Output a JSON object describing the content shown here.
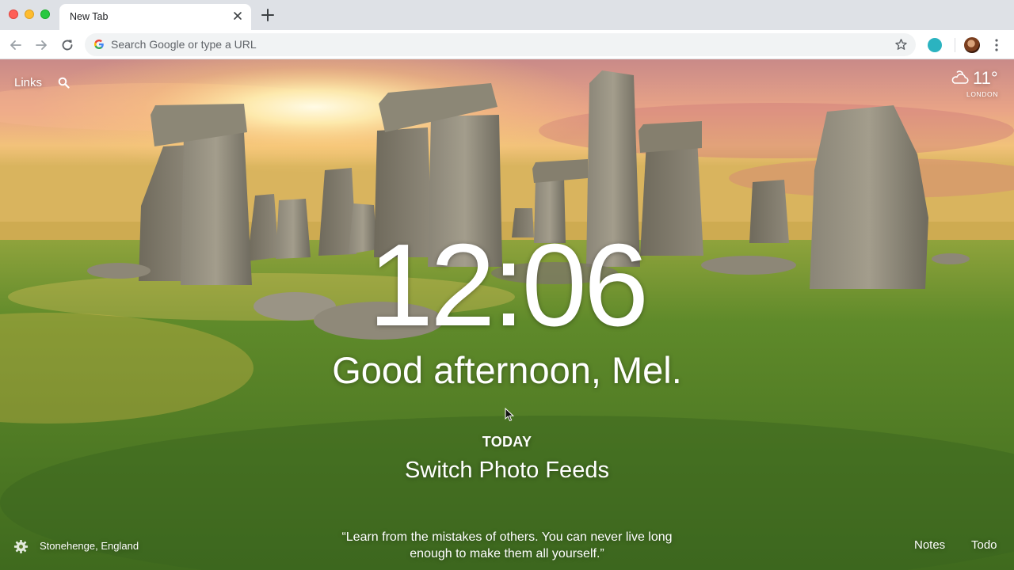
{
  "browser": {
    "tab_title": "New Tab",
    "omnibox_placeholder": "Search Google or type a URL"
  },
  "dashboard": {
    "links_label": "Links",
    "weather": {
      "temperature": "11°",
      "location": "LONDON",
      "icon": "partly-cloudy-icon"
    },
    "clock": "12:06",
    "greeting": "Good afternoon, Mel.",
    "focus": {
      "label": "TODAY",
      "text": "Switch Photo Feeds"
    },
    "photo_location": "Stonehenge, England",
    "quote": "“Learn from the mistakes of others. You can never live long enough to make them all yourself.”",
    "notes_label": "Notes",
    "todo_label": "Todo"
  },
  "colors": {
    "tabstrip": "#dee1e6",
    "ext_icon": "#2bb3c0"
  }
}
